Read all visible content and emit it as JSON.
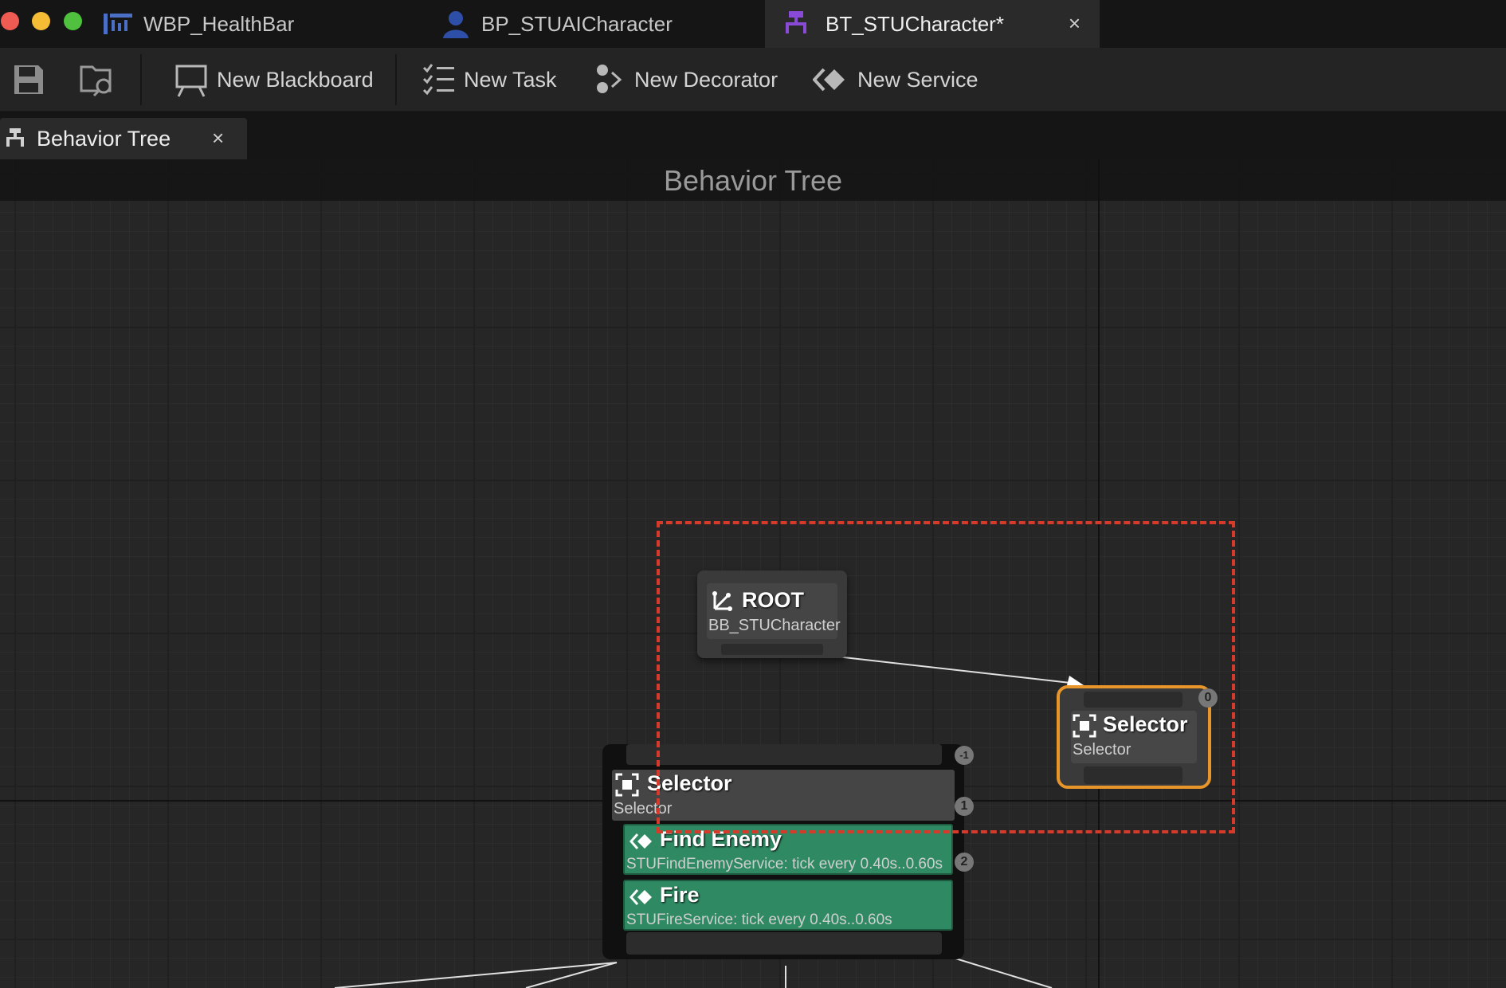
{
  "window": {
    "tabs": [
      {
        "label": "WBP_HealthBar",
        "icon": "widget-blueprint-icon"
      },
      {
        "label": "BP_STUAICharacter",
        "icon": "character-icon"
      },
      {
        "label": "BT_STUCharacter*",
        "icon": "behavior-tree-icon",
        "active": true
      }
    ],
    "close_glyph": "×"
  },
  "toolbar": {
    "save_icon": "save-icon",
    "browse_icon": "browse-icon",
    "new_blackboard": "New Blackboard",
    "new_task": "New Task",
    "new_decorator": "New Decorator",
    "new_service": "New Service"
  },
  "panel_tab": {
    "label": "Behavior Tree",
    "close_glyph": "×"
  },
  "graph": {
    "title": "Behavior Tree",
    "root": {
      "title": "ROOT",
      "subtitle": "BB_STUCharacter"
    },
    "selector_selected": {
      "title": "Selector",
      "subtitle": "Selector",
      "index": "0"
    },
    "selector_main": {
      "title": "Selector",
      "subtitle": "Selector",
      "index": "-1",
      "services": [
        {
          "title": "Find Enemy",
          "subtitle": "STUFindEnemyService: tick every 0.40s..0.60s",
          "index": "1"
        },
        {
          "title": "Fire",
          "subtitle": "STUFireService: tick every 0.40s..0.60s",
          "index": "2"
        }
      ]
    }
  },
  "colors": {
    "selection_outline": "#e8962a",
    "marquee": "#d63a2a",
    "service_node": "#2f8a63",
    "active_tab_icon": "#8a4ad8"
  }
}
